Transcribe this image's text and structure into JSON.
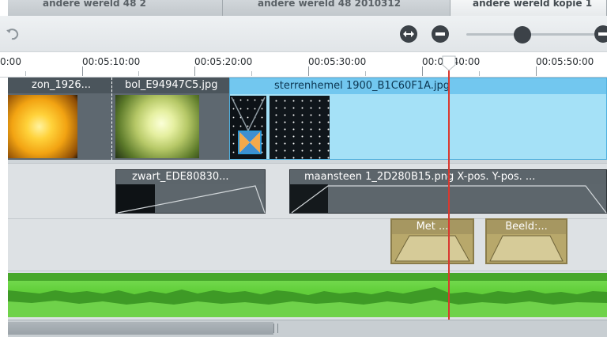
{
  "tabs": [
    {
      "label": "andere wereld 48 2",
      "active": false
    },
    {
      "label": "andere wereld 48 2010312",
      "active": false
    },
    {
      "label": "andere wereld  kopie 1",
      "active": true
    }
  ],
  "toolbar": {
    "icons": [
      "undo-icon",
      "fit-width-icon",
      "zoom-out-icon",
      "zoom-in-icon"
    ],
    "zoom_level_fraction": 0.4
  },
  "ruler": {
    "labels": [
      "0:00",
      "00:05:10:00",
      "00:05:20:00",
      "00:05:30:00",
      "00:05:40:00",
      "00:05:50:00"
    ],
    "playhead_partial_label": "00:"
  },
  "tracks": {
    "video": [
      {
        "label": "zon_1926..."
      },
      {
        "label": "bol_E94947C5.jpg"
      },
      {
        "label": "sterrenhemel 1900_B1C60F1A.jpg"
      }
    ],
    "overlay": [
      {
        "label": "zwart_EDE80830..."
      },
      {
        "label": "maansteen 1_2D280B15.png  X-pos.  Y-pos. ..."
      }
    ],
    "titles": [
      {
        "label": "Met ..."
      },
      {
        "label": "Beeld:..."
      }
    ]
  },
  "colors": {
    "selected_clip": "#a5e1f7",
    "playhead": "#d9382f",
    "audio": "#62cf3b",
    "title_clip": "#b8a86b"
  }
}
